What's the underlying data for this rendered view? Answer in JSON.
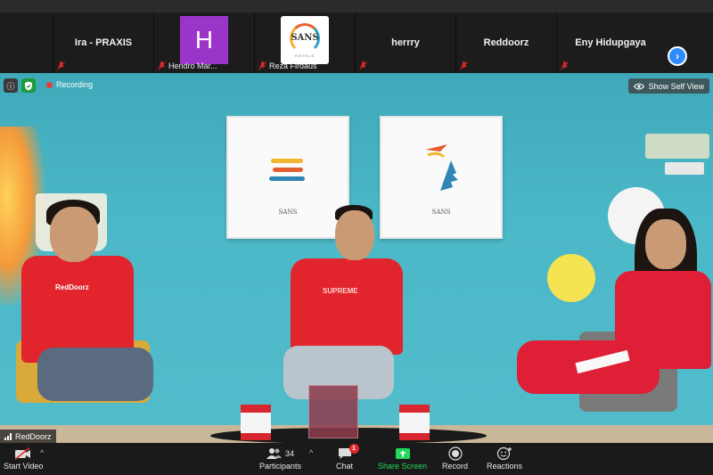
{
  "gallery": {
    "tiles": [
      {
        "name": "Ira - PRAXIS",
        "muted": true
      },
      {
        "label": "Hendro Mar...",
        "avatar_letter": "H",
        "avatar_color": "#9b35c9",
        "muted": true
      },
      {
        "label": "Reza Firdaus",
        "logo_text": "SANS",
        "logo_sub": "HOTELS",
        "muted": true
      },
      {
        "name": "herrry",
        "muted": true
      },
      {
        "name": "Reddoorz",
        "muted": true
      },
      {
        "name": "Eny Hidupgaya",
        "muted": true
      }
    ],
    "next_icon": "chevron-right-icon"
  },
  "video": {
    "recording_label": "Recording",
    "show_self_view_label": "Show Self View",
    "speaker_name": "RedDoorz",
    "frame_left_text": "SANS",
    "frame_right_text": "SANS",
    "shirt_left_text": "RedDoorz",
    "shirt_mid_text": "SUPREME"
  },
  "toolbar": {
    "start_video": "Start Video",
    "participants": "Participants",
    "participants_count": "34",
    "chat": "Chat",
    "chat_badge": "1",
    "share_screen": "Share Screen",
    "record": "Record",
    "reactions": "Reactions"
  },
  "colors": {
    "accent_blue": "#2d8cff",
    "share_green": "#23d959",
    "mute_red": "#e02828"
  }
}
